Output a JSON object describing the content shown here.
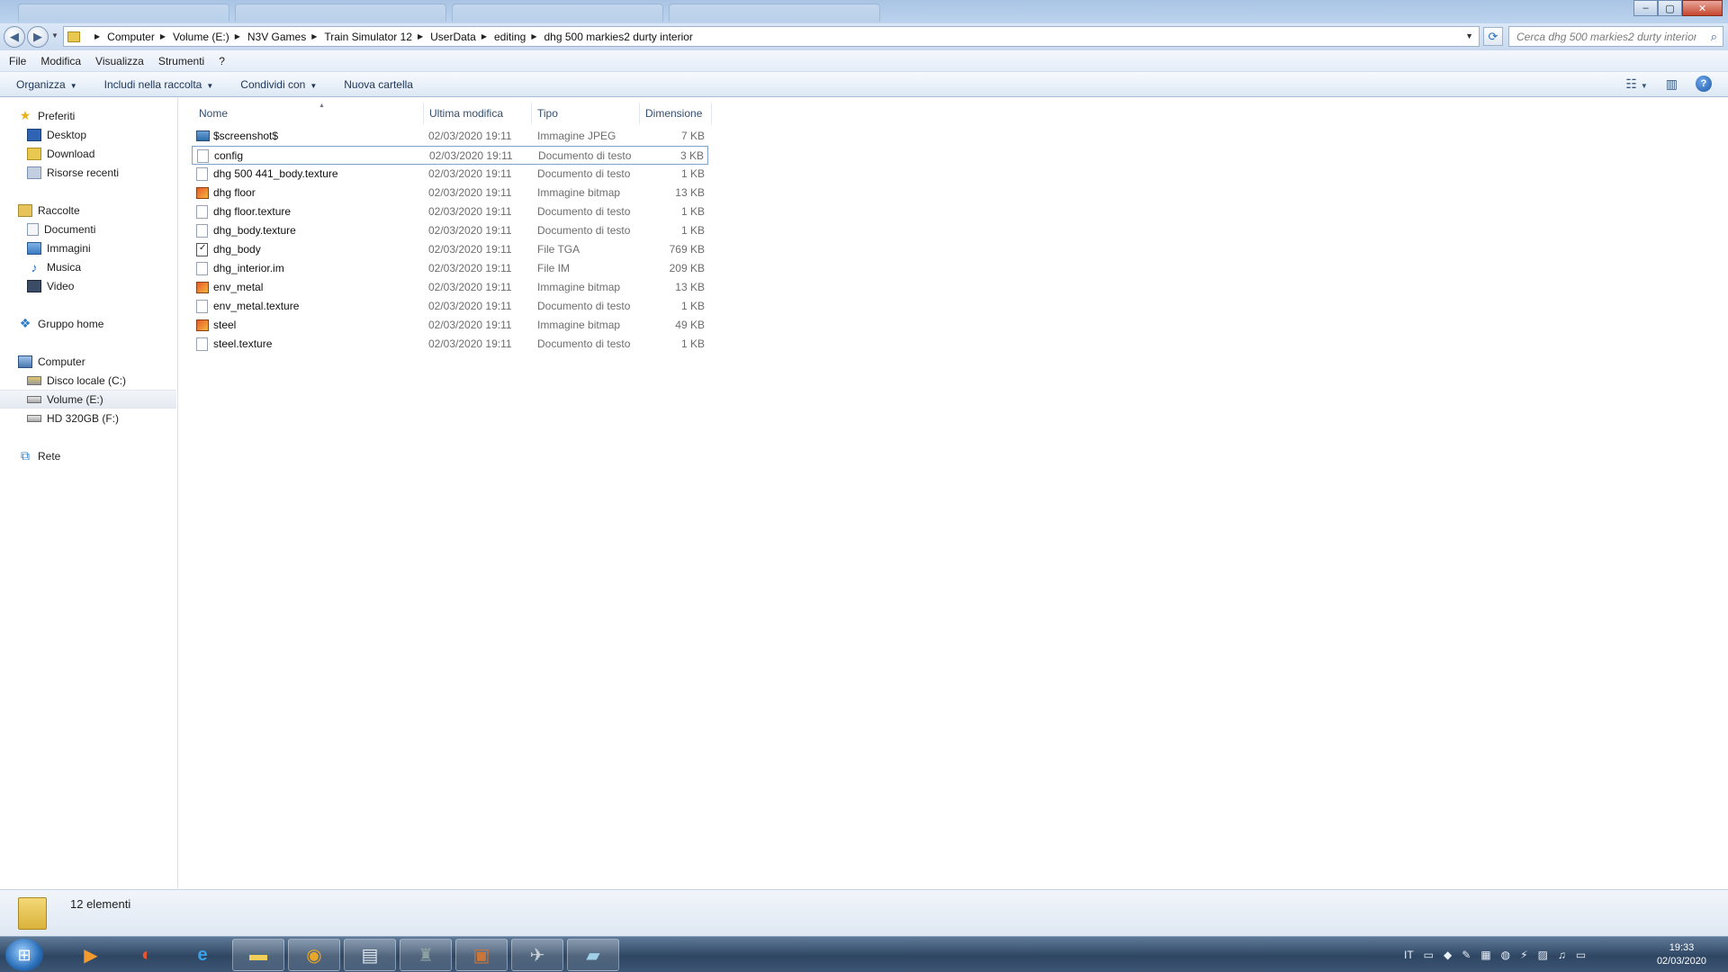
{
  "window": {
    "controls": {
      "minimize": "–",
      "maximize": "▢",
      "close": "✕"
    }
  },
  "address": {
    "breadcrumbs": [
      "Computer",
      "Volume (E:)",
      "N3V Games",
      "Train Simulator 12",
      "UserData",
      "editing",
      "dhg 500 markies2 durty interior"
    ],
    "search_placeholder": "Cerca dhg 500 markies2 durty interior"
  },
  "menu": [
    "File",
    "Modifica",
    "Visualizza",
    "Strumenti",
    "?"
  ],
  "commands": {
    "organize": "Organizza",
    "include": "Includi nella raccolta",
    "share": "Condividi con",
    "new_folder": "Nuova cartella"
  },
  "sidebar": {
    "favorites": {
      "label": "Preferiti",
      "items": [
        "Desktop",
        "Download",
        "Risorse recenti"
      ]
    },
    "libraries": {
      "label": "Raccolte",
      "items": [
        "Documenti",
        "Immagini",
        "Musica",
        "Video"
      ]
    },
    "homegroup": "Gruppo home",
    "computer": {
      "label": "Computer",
      "items": [
        "Disco locale (C:)",
        "Volume (E:)",
        "HD 320GB (F:)"
      ],
      "selected": "Volume (E:)"
    },
    "network": "Rete"
  },
  "columns": {
    "name": "Nome",
    "date": "Ultima modifica",
    "type": "Tipo",
    "size": "Dimensione"
  },
  "files": [
    {
      "name": "$screenshot$",
      "date": "02/03/2020 19:11",
      "type": "Immagine JPEG",
      "size": "7 KB",
      "icon": "jpeg"
    },
    {
      "name": "config",
      "date": "02/03/2020 19:11",
      "type": "Documento di testo",
      "size": "3 KB",
      "icon": "txt",
      "selected": true
    },
    {
      "name": "dhg 500 441_body.texture",
      "date": "02/03/2020 19:11",
      "type": "Documento di testo",
      "size": "1 KB",
      "icon": "txt"
    },
    {
      "name": "dhg floor",
      "date": "02/03/2020 19:11",
      "type": "Immagine bitmap",
      "size": "13 KB",
      "icon": "bmp"
    },
    {
      "name": "dhg floor.texture",
      "date": "02/03/2020 19:11",
      "type": "Documento di testo",
      "size": "1 KB",
      "icon": "txt"
    },
    {
      "name": "dhg_body.texture",
      "date": "02/03/2020 19:11",
      "type": "Documento di testo",
      "size": "1 KB",
      "icon": "txt"
    },
    {
      "name": "dhg_body",
      "date": "02/03/2020 19:11",
      "type": "File TGA",
      "size": "769 KB",
      "icon": "tga"
    },
    {
      "name": "dhg_interior.im",
      "date": "02/03/2020 19:11",
      "type": "File IM",
      "size": "209 KB",
      "icon": "txt"
    },
    {
      "name": "env_metal",
      "date": "02/03/2020 19:11",
      "type": "Immagine bitmap",
      "size": "13 KB",
      "icon": "bmp"
    },
    {
      "name": "env_metal.texture",
      "date": "02/03/2020 19:11",
      "type": "Documento di testo",
      "size": "1 KB",
      "icon": "txt"
    },
    {
      "name": "steel",
      "date": "02/03/2020 19:11",
      "type": "Immagine bitmap",
      "size": "49 KB",
      "icon": "bmp"
    },
    {
      "name": "steel.texture",
      "date": "02/03/2020 19:11",
      "type": "Documento di testo",
      "size": "1 KB",
      "icon": "txt"
    }
  ],
  "status": {
    "count": "12 elementi"
  },
  "taskbar": {
    "apps": [
      "media-player-icon",
      "ccleaner-icon",
      "internet-explorer-icon",
      "file-explorer-icon",
      "chrome-icon",
      "notepad-icon",
      "game-icon",
      "archive-icon",
      "train-sim-icon",
      "editor-icon"
    ],
    "language": "IT",
    "time": "19:33",
    "date": "02/03/2020"
  }
}
